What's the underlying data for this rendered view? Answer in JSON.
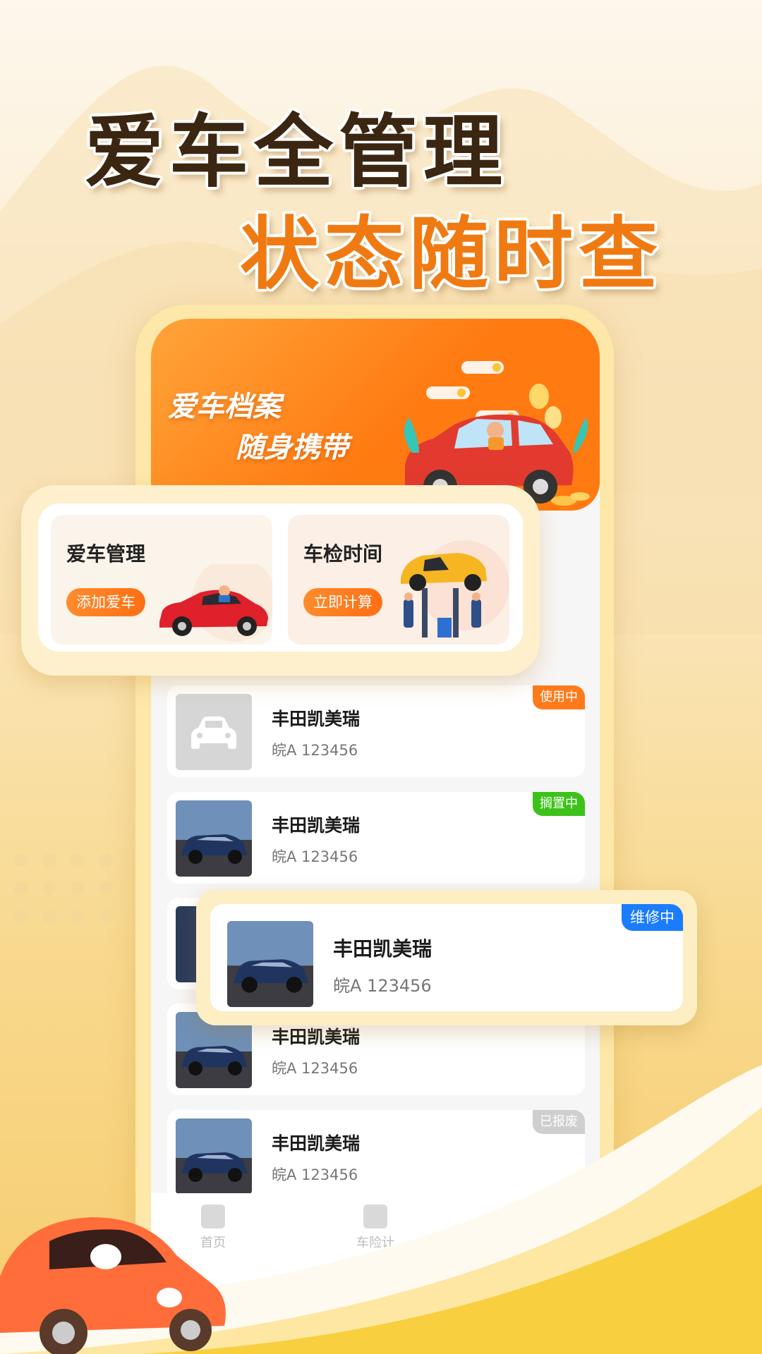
{
  "headline": {
    "line1": "爱车全管理",
    "line2": "状态随时查"
  },
  "banner": {
    "line1": "爱车档案",
    "line2": "随身携带"
  },
  "quick_actions": [
    {
      "title": "爱车管理",
      "button": "添加爱车"
    },
    {
      "title": "车检时间",
      "button": "立即计算"
    }
  ],
  "cars": [
    {
      "name": "丰田凯美瑞",
      "plate": "皖A 123456",
      "status": "使用中",
      "status_color": "#ff7a1a",
      "thumb": "car-placeholder-icon"
    },
    {
      "name": "丰田凯美瑞",
      "plate": "皖A 123456",
      "status": "搁置中",
      "status_color": "#3cc21a",
      "thumb": "suv-photo"
    },
    {
      "name": "丰田凯美瑞",
      "plate": "皖A 123456",
      "status": "维修中",
      "status_color": "#1a7cff",
      "thumb": "suv-photo"
    },
    {
      "name": "丰田凯美瑞",
      "plate": "皖A 123456",
      "status": "",
      "status_color": "#8f86f2",
      "thumb": "suv-photo"
    },
    {
      "name": "丰田凯美瑞",
      "plate": "皖A 123456",
      "status": "已报废",
      "status_color": "#cfcfcf",
      "thumb": "suv-photo"
    }
  ],
  "bottom_nav": {
    "home": "首页",
    "calc": "车险计"
  },
  "colors": {
    "accent": "#ff7b12",
    "background": "#fbe9c6"
  }
}
